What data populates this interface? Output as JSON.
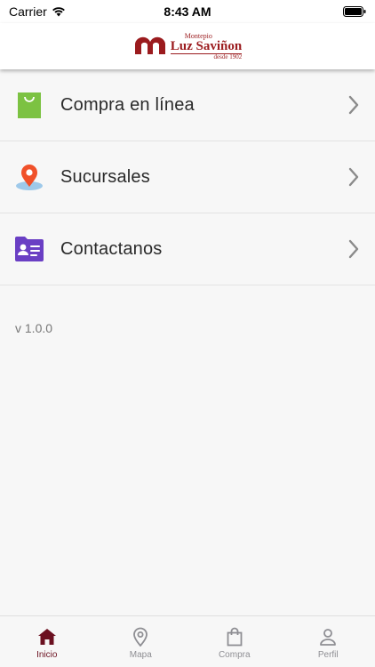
{
  "status_bar": {
    "carrier": "Carrier",
    "time": "8:43 AM"
  },
  "header": {
    "logo_small": "Montepio",
    "logo_main": "Luz Saviñon",
    "logo_since": "desde 1902"
  },
  "menu": {
    "items": [
      {
        "label": "Compra en línea",
        "icon": "shopping-bag-icon"
      },
      {
        "label": "Sucursales",
        "icon": "location-pin-icon"
      },
      {
        "label": "Contactanos",
        "icon": "contact-card-icon"
      }
    ]
  },
  "version": "v 1.0.0",
  "tabbar": {
    "tabs": [
      {
        "label": "Inicio",
        "icon": "home-icon",
        "active": true
      },
      {
        "label": "Mapa",
        "icon": "map-pin-icon",
        "active": false
      },
      {
        "label": "Compra",
        "icon": "bag-icon",
        "active": false
      },
      {
        "label": "Perfil",
        "icon": "user-icon",
        "active": false
      }
    ]
  },
  "colors": {
    "brand": "#9b1b1e",
    "active_tab": "#6b1020",
    "inactive_tab": "#8e8e93",
    "bag_green": "#7cc242",
    "pin_orange": "#f0512a",
    "card_purple": "#6a3fc4"
  }
}
